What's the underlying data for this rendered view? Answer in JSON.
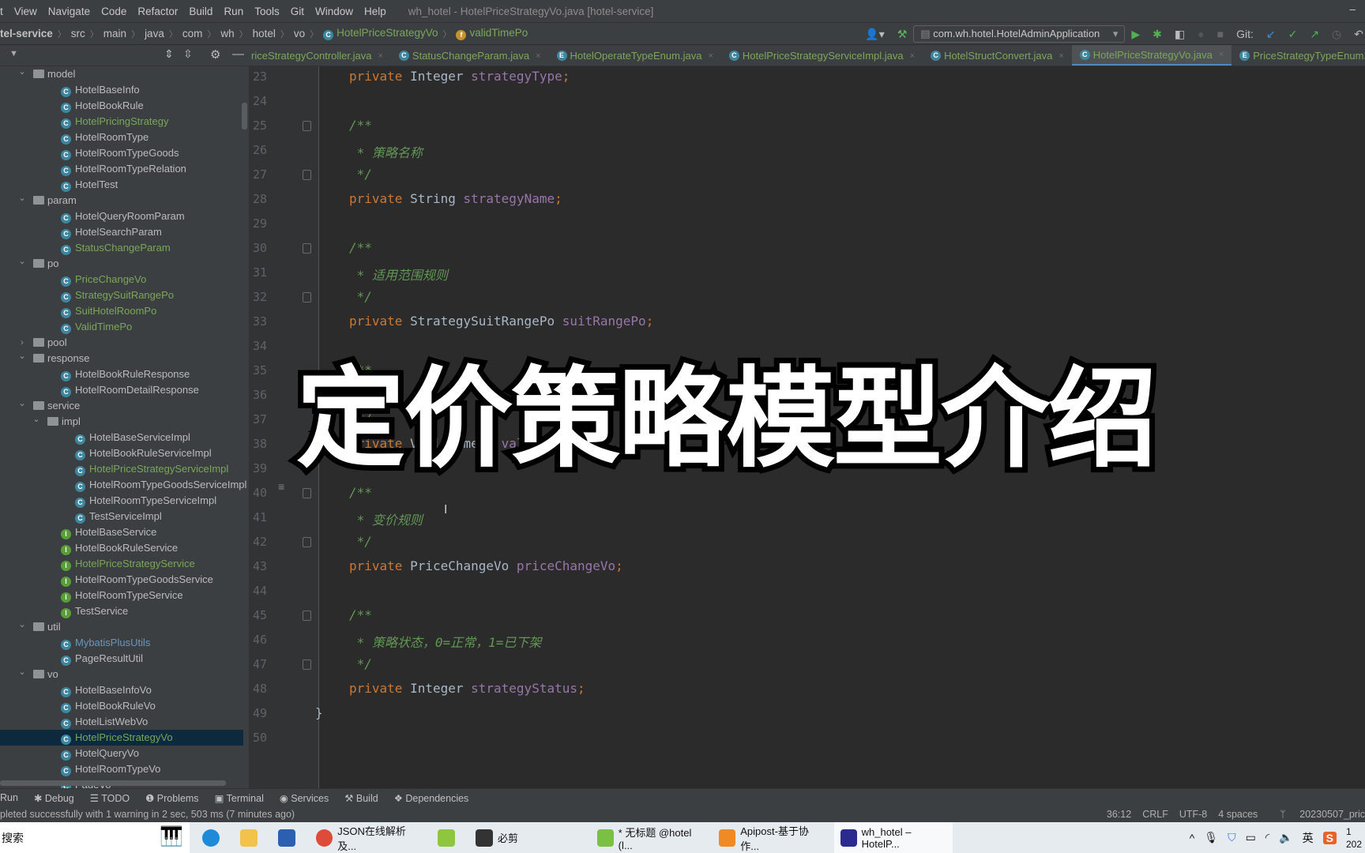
{
  "menu": {
    "items": [
      "t",
      "View",
      "Navigate",
      "Code",
      "Refactor",
      "Build",
      "Run",
      "Tools",
      "Git",
      "Window",
      "Help"
    ],
    "window_title": "wh_hotel - HotelPriceStrategyVo.java [hotel-service]",
    "minimize": "–"
  },
  "breadcrumb": {
    "items": [
      "tel-service",
      "src",
      "main",
      "java",
      "com",
      "wh",
      "hotel",
      "vo"
    ],
    "class_name": "HotelPriceStrategyVo",
    "field_name": "validTimePo"
  },
  "toolbar": {
    "run_config": "com.wh.hotel.HotelAdminApplication",
    "git_label": "Git:"
  },
  "tabs": [
    {
      "label": "riceStrategyController.java",
      "icon": "class-icon",
      "active": false
    },
    {
      "label": "StatusChangeParam.java",
      "icon": "class-icon",
      "active": false
    },
    {
      "label": "HotelOperateTypeEnum.java",
      "icon": "enum-icon",
      "active": false
    },
    {
      "label": "HotelPriceStrategyServiceImpl.java",
      "icon": "class-icon",
      "active": false
    },
    {
      "label": "HotelStructConvert.java",
      "icon": "class-icon",
      "active": false
    },
    {
      "label": "HotelPriceStrategyVo.java",
      "icon": "class-icon",
      "active": true
    },
    {
      "label": "PriceStrategyTypeEnum.java",
      "icon": "enum-icon",
      "active": false
    }
  ],
  "colors": {
    "modified": "#7ba65b",
    "normal": "#bbbbbb",
    "blue": "#6897bb",
    "selection": "#0d293e",
    "accent": "#4a88c7"
  },
  "tree": [
    {
      "label": "model",
      "type": "folder",
      "depth": 1,
      "open": true
    },
    {
      "label": "HotelBaseInfo",
      "type": "class",
      "depth": 2
    },
    {
      "label": "HotelBookRule",
      "type": "class",
      "depth": 2
    },
    {
      "label": "HotelPricingStrategy",
      "type": "class",
      "depth": 2,
      "status": "modified"
    },
    {
      "label": "HotelRoomType",
      "type": "class",
      "depth": 2
    },
    {
      "label": "HotelRoomTypeGoods",
      "type": "class",
      "depth": 2
    },
    {
      "label": "HotelRoomTypeRelation",
      "type": "class",
      "depth": 2
    },
    {
      "label": "HotelTest",
      "type": "class",
      "depth": 2
    },
    {
      "label": "param",
      "type": "folder",
      "depth": 1,
      "open": true
    },
    {
      "label": "HotelQueryRoomParam",
      "type": "class",
      "depth": 2
    },
    {
      "label": "HotelSearchParam",
      "type": "class",
      "depth": 2
    },
    {
      "label": "StatusChangeParam",
      "type": "class",
      "depth": 2,
      "status": "modified"
    },
    {
      "label": "po",
      "type": "folder",
      "depth": 1,
      "open": true
    },
    {
      "label": "PriceChangeVo",
      "type": "class",
      "depth": 2,
      "status": "modified"
    },
    {
      "label": "StrategySuitRangePo",
      "type": "class",
      "depth": 2,
      "status": "modified"
    },
    {
      "label": "SuitHotelRoomPo",
      "type": "class",
      "depth": 2,
      "status": "modified"
    },
    {
      "label": "ValidTimePo",
      "type": "class",
      "depth": 2,
      "status": "modified"
    },
    {
      "label": "pool",
      "type": "folder",
      "depth": 1,
      "open": false
    },
    {
      "label": "response",
      "type": "folder",
      "depth": 1,
      "open": true
    },
    {
      "label": "HotelBookRuleResponse",
      "type": "class",
      "depth": 2
    },
    {
      "label": "HotelRoomDetailResponse",
      "type": "class",
      "depth": 2
    },
    {
      "label": "service",
      "type": "folder",
      "depth": 1,
      "open": true
    },
    {
      "label": "impl",
      "type": "folder",
      "depth": 2,
      "open": true
    },
    {
      "label": "HotelBaseServiceImpl",
      "type": "class",
      "depth": 3
    },
    {
      "label": "HotelBookRuleServiceImpl",
      "type": "class",
      "depth": 3
    },
    {
      "label": "HotelPriceStrategyServiceImpl",
      "type": "class",
      "depth": 3,
      "status": "modified"
    },
    {
      "label": "HotelRoomTypeGoodsServiceImpl",
      "type": "class",
      "depth": 3
    },
    {
      "label": "HotelRoomTypeServiceImpl",
      "type": "class",
      "depth": 3
    },
    {
      "label": "TestServiceImpl",
      "type": "class",
      "depth": 3
    },
    {
      "label": "HotelBaseService",
      "type": "interface",
      "depth": 2
    },
    {
      "label": "HotelBookRuleService",
      "type": "interface",
      "depth": 2
    },
    {
      "label": "HotelPriceStrategyService",
      "type": "interface",
      "depth": 2,
      "status": "modified"
    },
    {
      "label": "HotelRoomTypeGoodsService",
      "type": "interface",
      "depth": 2
    },
    {
      "label": "HotelRoomTypeService",
      "type": "interface",
      "depth": 2
    },
    {
      "label": "TestService",
      "type": "interface",
      "depth": 2
    },
    {
      "label": "util",
      "type": "folder",
      "depth": 1,
      "open": true
    },
    {
      "label": "MybatisPlusUtils",
      "type": "class",
      "depth": 2,
      "status": "blue"
    },
    {
      "label": "PageResultUtil",
      "type": "class",
      "depth": 2
    },
    {
      "label": "vo",
      "type": "folder",
      "depth": 1,
      "open": true
    },
    {
      "label": "HotelBaseInfoVo",
      "type": "class",
      "depth": 2
    },
    {
      "label": "HotelBookRuleVo",
      "type": "class",
      "depth": 2
    },
    {
      "label": "HotelListWebVo",
      "type": "class",
      "depth": 2
    },
    {
      "label": "HotelPriceStrategyVo",
      "type": "class",
      "depth": 2,
      "status": "modified",
      "selected": true
    },
    {
      "label": "HotelQueryVo",
      "type": "class",
      "depth": 2
    },
    {
      "label": "HotelRoomTypeVo",
      "type": "class",
      "depth": 2
    },
    {
      "label": "PageVo",
      "type": "class",
      "depth": 2
    }
  ],
  "code": {
    "first_line": 23,
    "lines": [
      [
        [
          "kw",
          "private "
        ],
        [
          "ty",
          "Integer "
        ],
        [
          "fd",
          "strategyType"
        ],
        [
          "kw",
          ";"
        ]
      ],
      [],
      [
        [
          "cm",
          "/**"
        ]
      ],
      [
        [
          "cm",
          " * 策略名称"
        ]
      ],
      [
        [
          "cm",
          " */"
        ]
      ],
      [
        [
          "kw",
          "private "
        ],
        [
          "ty",
          "String "
        ],
        [
          "fd",
          "strategyName"
        ],
        [
          "kw",
          ";"
        ]
      ],
      [],
      [
        [
          "cm",
          "/**"
        ]
      ],
      [
        [
          "cm",
          " * 适用范围规则"
        ]
      ],
      [
        [
          "cm",
          " */"
        ]
      ],
      [
        [
          "kw",
          "private "
        ],
        [
          "ty",
          "StrategySuitRangePo "
        ],
        [
          "fd",
          "suitRangePo"
        ],
        [
          "kw",
          ";"
        ]
      ],
      [],
      [
        [
          "cm",
          "/**"
        ]
      ],
      [
        [
          "cm",
          " *"
        ]
      ],
      [
        [
          "cm",
          " */"
        ]
      ],
      [
        [
          "kw",
          "private "
        ],
        [
          "ty",
          "ValidTimePo "
        ],
        [
          "fd",
          "validTimePo"
        ],
        [
          "kw",
          ";"
        ]
      ],
      [],
      [
        [
          "cm",
          "/**"
        ]
      ],
      [
        [
          "cm",
          " * 变价规则"
        ]
      ],
      [
        [
          "cm",
          " */"
        ]
      ],
      [
        [
          "kw",
          "private "
        ],
        [
          "ty",
          "PriceChangeVo "
        ],
        [
          "fd",
          "priceChangeVo"
        ],
        [
          "kw",
          ";"
        ]
      ],
      [],
      [
        [
          "cm",
          "/**"
        ]
      ],
      [
        [
          "cm",
          " * 策略状态，0=正常，1=已下架"
        ]
      ],
      [
        [
          "cm",
          " */"
        ]
      ],
      [
        [
          "kw",
          "private "
        ],
        [
          "ty",
          "Integer "
        ],
        [
          "fd",
          "strategyStatus"
        ],
        [
          "kw",
          ";"
        ]
      ],
      [
        [
          "ty",
          "}"
        ]
      ],
      []
    ],
    "fold_start_lines": [
      25,
      30,
      40,
      45
    ],
    "fold_end_lines": [
      27,
      32,
      42,
      47
    ]
  },
  "overlay_title": "定价策略模型介绍",
  "tool_windows": [
    "Run",
    "Debug",
    "TODO",
    "Problems",
    "Terminal",
    "Services",
    "Build",
    "Dependencies"
  ],
  "status": {
    "message": "pleted successfully with 1 warning in 2 sec, 503 ms (7 minutes ago)",
    "position": "36:12",
    "line_sep": "CRLF",
    "encoding": "UTF-8",
    "indent": "4 spaces",
    "branch": "20230507_pric"
  },
  "taskbar": {
    "search": "搜索",
    "apps": [
      {
        "label": "",
        "icon": "edge-icon",
        "color": "#1f8ad8"
      },
      {
        "label": "",
        "icon": "file-explorer-icon",
        "color": "#f2c24a"
      },
      {
        "label": "",
        "icon": "store-icon",
        "color": "#2d5fb0"
      },
      {
        "label": "JSON在线解析及...",
        "icon": "chrome-icon",
        "color": "#dd4b39"
      },
      {
        "label": "",
        "icon": "notepad-icon",
        "color": "#8fc63f"
      },
      {
        "label": "必剪",
        "icon": "bijian-icon",
        "color": "#333333"
      },
      {
        "label": "* 无标题 @hotel (l...",
        "icon": "navicat-icon",
        "color": "#7ac043"
      },
      {
        "label": "Apipost-基于协作...",
        "icon": "apipost-icon",
        "color": "#f08a24"
      },
      {
        "label": "wh_hotel – HotelP...",
        "icon": "intellij-icon",
        "color": "#2b2b8f",
        "active": true
      }
    ],
    "ime": "英",
    "clock_time": "1",
    "clock_date": "202"
  }
}
